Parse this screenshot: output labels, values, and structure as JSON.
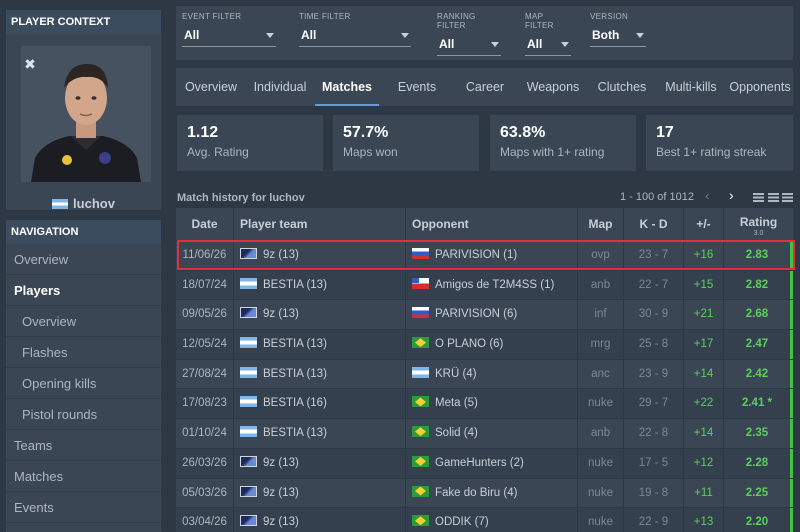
{
  "player_context": {
    "header": "PLAYER CONTEXT",
    "name": "luchov"
  },
  "navigation": {
    "header": "NAVIGATION",
    "items": [
      {
        "label": "Overview"
      },
      {
        "label": "Players"
      },
      {
        "label": "Overview"
      },
      {
        "label": "Flashes"
      },
      {
        "label": "Opening kills"
      },
      {
        "label": "Pistol rounds"
      },
      {
        "label": "Teams"
      },
      {
        "label": "Matches"
      },
      {
        "label": "Events"
      }
    ]
  },
  "filters": {
    "event": {
      "label": "EVENT FILTER",
      "value": "All"
    },
    "time": {
      "label": "TIME FILTER",
      "value": "All"
    },
    "ranking": {
      "label": "RANKING FILTER",
      "value": "All"
    },
    "map": {
      "label": "MAP FILTER",
      "value": "All"
    },
    "version": {
      "label": "VERSION",
      "value": "Both"
    }
  },
  "tabs": [
    "Overview",
    "Individual",
    "Matches",
    "Events",
    "Career",
    "Weapons",
    "Clutches",
    "Multi-kills",
    "Opponents"
  ],
  "active_tab": "Matches",
  "stats": [
    {
      "value": "1.12",
      "label": "Avg. Rating"
    },
    {
      "value": "57.7%",
      "label": "Maps won"
    },
    {
      "value": "63.8%",
      "label": "Maps with 1+ rating"
    },
    {
      "value": "17",
      "label": "Best 1+ rating streak"
    }
  ],
  "history": {
    "title": "Match history for luchov",
    "pager": "1 - 100 of 1012",
    "prev": "‹",
    "next": "›"
  },
  "table": {
    "headers": {
      "date": "Date",
      "team": "Player team",
      "opponent": "Opponent",
      "map": "Map",
      "kd": "K - D",
      "pm": "+/-",
      "rating": "Rating",
      "rating_version": "3.0"
    },
    "rows": [
      {
        "date": "11/06/26",
        "team": "9z (13)",
        "team_flag": "9z",
        "opp": "PARIVISION (1)",
        "opp_flag": "ru",
        "map": "ovp",
        "kd": "23 - 7",
        "pm": "+16",
        "rating": "2.83"
      },
      {
        "date": "18/07/24",
        "team": "BESTIA (13)",
        "team_flag": "ar",
        "opp": "Amigos de T2M4SS (1)",
        "opp_flag": "cl",
        "map": "anb",
        "kd": "22 - 7",
        "pm": "+15",
        "rating": "2.82"
      },
      {
        "date": "09/05/26",
        "team": "9z (13)",
        "team_flag": "9z",
        "opp": "PARIVISION (6)",
        "opp_flag": "ru",
        "map": "inf",
        "kd": "30 - 9",
        "pm": "+21",
        "rating": "2.68"
      },
      {
        "date": "12/05/24",
        "team": "BESTIA (13)",
        "team_flag": "ar",
        "opp": "O PLANO (6)",
        "opp_flag": "br",
        "map": "mrg",
        "kd": "25 - 8",
        "pm": "+17",
        "rating": "2.47"
      },
      {
        "date": "27/08/24",
        "team": "BESTIA (13)",
        "team_flag": "ar",
        "opp": "KRÜ (4)",
        "opp_flag": "ar",
        "map": "anc",
        "kd": "23 - 9",
        "pm": "+14",
        "rating": "2.42"
      },
      {
        "date": "17/08/23",
        "team": "BESTIA (16)",
        "team_flag": "ar",
        "opp": "Meta (5)",
        "opp_flag": "br",
        "map": "nuke",
        "kd": "29 - 7",
        "pm": "+22",
        "rating": "2.41 *"
      },
      {
        "date": "01/10/24",
        "team": "BESTIA (13)",
        "team_flag": "ar",
        "opp": "Solid (4)",
        "opp_flag": "br",
        "map": "anb",
        "kd": "22 - 8",
        "pm": "+14",
        "rating": "2.35"
      },
      {
        "date": "26/03/26",
        "team": "9z (13)",
        "team_flag": "9z",
        "opp": "GameHunters (2)",
        "opp_flag": "br",
        "map": "nuke",
        "kd": "17 - 5",
        "pm": "+12",
        "rating": "2.28"
      },
      {
        "date": "05/03/26",
        "team": "9z (13)",
        "team_flag": "9z",
        "opp": "Fake do Biru (4)",
        "opp_flag": "br",
        "map": "nuke",
        "kd": "19 - 8",
        "pm": "+11",
        "rating": "2.25"
      },
      {
        "date": "03/04/26",
        "team": "9z (13)",
        "team_flag": "9z",
        "opp": "ODDIK (7)",
        "opp_flag": "br",
        "map": "nuke",
        "kd": "22 - 9",
        "pm": "+13",
        "rating": "2.20"
      }
    ]
  },
  "colors": {
    "positive": "#5bd05b",
    "highlight": "#e03040",
    "accent": "#5aa0d8"
  }
}
